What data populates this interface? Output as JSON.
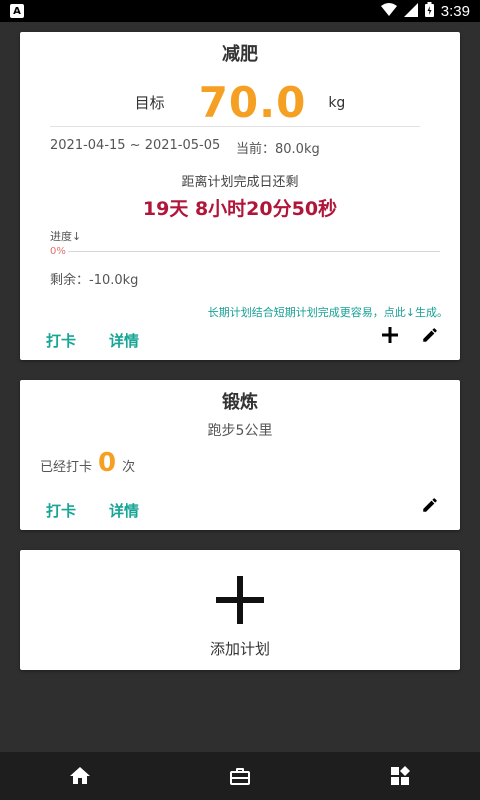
{
  "status": {
    "time": "3:39",
    "app_badge": "A"
  },
  "weight_plan": {
    "title": "减肥",
    "goal_label": "目标",
    "goal_value": "70.0",
    "goal_unit": "kg",
    "date_range": "2021-04-15 ~ 2021-05-05",
    "current": "当前：80.0kg",
    "countdown_label": "距离计划完成日还剩",
    "countdown": "19天  8小时20分50秒",
    "progress_label": "进度↓",
    "progress_percent": "0%",
    "remaining": "剩余：-10.0kg",
    "hint": "长期计划结合短期计划完成更容易，点此↓生成。",
    "checkin_label": "打卡",
    "details_label": "详情"
  },
  "exercise_plan": {
    "title": "锻炼",
    "subtitle": "跑步5公里",
    "checked_prefix": "已经打卡",
    "checked_count": "0",
    "checked_unit": "次",
    "checkin_label": "打卡",
    "details_label": "详情"
  },
  "add_plan": {
    "label": "添加计划"
  },
  "colors": {
    "accent": "#17a596",
    "highlight": "#f5a023",
    "countdown": "#b0163a"
  },
  "nav": {
    "items": [
      "home-icon",
      "briefcase-icon",
      "dashboard-icon"
    ]
  }
}
